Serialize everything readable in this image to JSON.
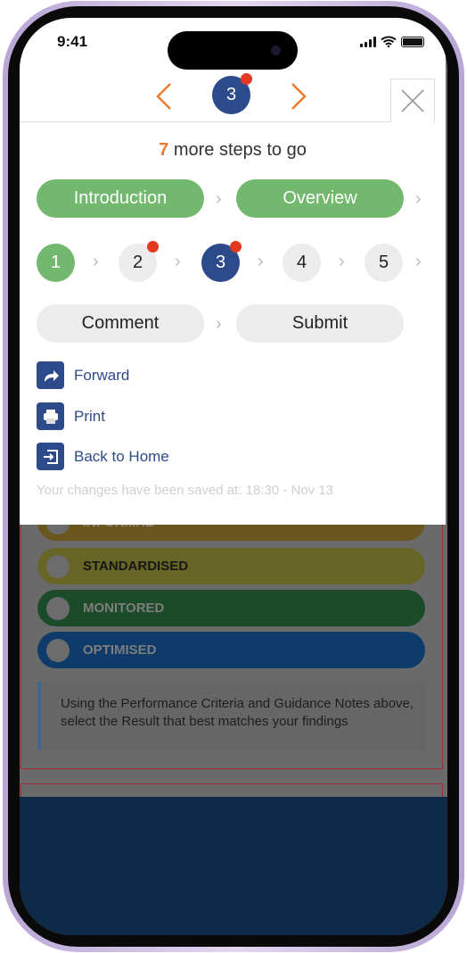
{
  "status_bar": {
    "time": "9:41"
  },
  "header": {
    "current_step": "3",
    "prev_icon": "chevron-left-icon",
    "next_icon": "chevron-right-icon",
    "close_icon": "close-icon"
  },
  "progress": {
    "remaining_count": "7",
    "remaining_text": "more steps to go"
  },
  "sections": [
    {
      "label": "Introduction",
      "state": "complete"
    },
    {
      "label": "Overview",
      "state": "complete"
    }
  ],
  "steps": [
    {
      "label": "1",
      "state": "complete",
      "flag": false
    },
    {
      "label": "2",
      "state": "pending",
      "flag": true
    },
    {
      "label": "3",
      "state": "current",
      "flag": true
    },
    {
      "label": "4",
      "state": "pending",
      "flag": false
    },
    {
      "label": "5",
      "state": "pending",
      "flag": false
    }
  ],
  "final_steps": [
    {
      "label": "Comment"
    },
    {
      "label": "Submit"
    }
  ],
  "actions": [
    {
      "label": "Forward",
      "icon": "forward-icon"
    },
    {
      "label": "Print",
      "icon": "print-icon"
    },
    {
      "label": "Back to Home",
      "icon": "exit-icon"
    }
  ],
  "saved_text": "Your changes have been saved at: 18:30 - Nov 13",
  "results": [
    {
      "label": "INFORMAL",
      "color": "#6b5620"
    },
    {
      "label": "STANDARDISED",
      "color": "#676626"
    },
    {
      "label": "MONITORED",
      "color": "#1b4b28"
    },
    {
      "label": "OPTIMISED",
      "color": "#0f3b6a"
    }
  ],
  "note": "Using the Performance Criteria and Guidance Notes above, select the Result that best matches your findings",
  "colors": {
    "accent": "#f07a2c",
    "primary": "#2d4a8a",
    "complete": "#72b86e",
    "flag": "#e33a22"
  }
}
